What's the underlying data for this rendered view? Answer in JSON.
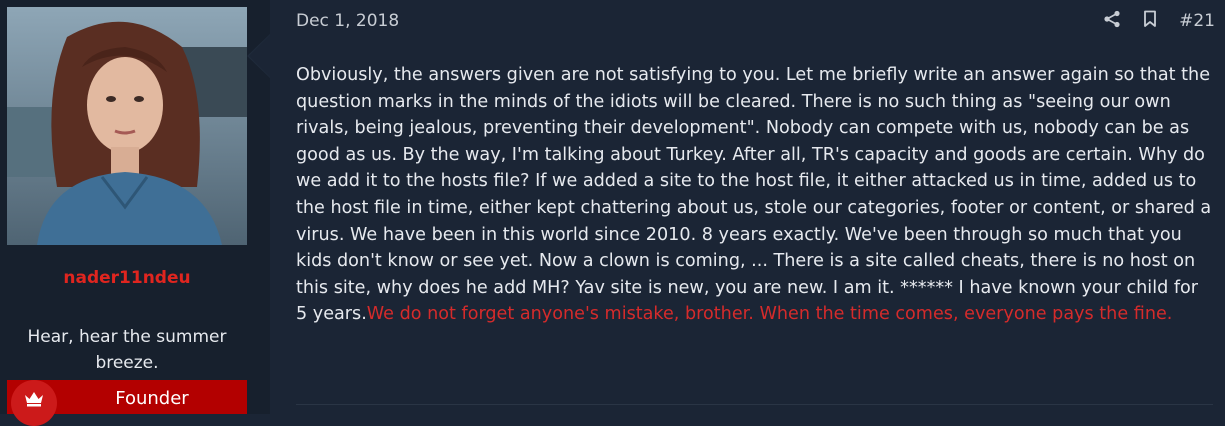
{
  "user": {
    "username": "nader11ndeu",
    "user_title": "Hear, hear the summer breeze.",
    "banner": "Founder",
    "avatar_icon": "avatar-photo",
    "banner_icon": "crown-icon"
  },
  "post": {
    "date": "Dec 1, 2018",
    "number": "#21",
    "icons": [
      "share-icon",
      "bookmark-icon"
    ],
    "body_text": "Obviously, the answers given are not satisfying to you. Let me briefly write an answer again so that the question marks in the minds of the idiots will be cleared. There is no such thing as \"seeing our own rivals, being jealous, preventing their development\". Nobody can compete with us, nobody can be as good as us. By the way, I'm talking about Turkey. After all, TR's capacity and goods are certain. Why do we add it to the hosts file? If we added a site to the host file, it either attacked us in time, added us to the host file in time, either kept chattering about us, stole our categories, footer or content, or shared a virus. We have been in this world since 2010. 8 years exactly. We've been through so much that you kids don't know or see yet. Now a clown is coming, ... There is a site called cheats, there is no host on this site, why does he add MH? Yav site is new, you are new. I am it. ****** I have known your child for 5 years.",
    "highlight_text": "We do not forget anyone's mistake, brother. When the time comes, everyone pays the fine."
  },
  "colors": {
    "page_bg": "#1b2535",
    "sidebar_bg": "#17202d",
    "username": "#e0251f",
    "banner_bg": "#b30000",
    "highlight": "#d52b2b"
  }
}
